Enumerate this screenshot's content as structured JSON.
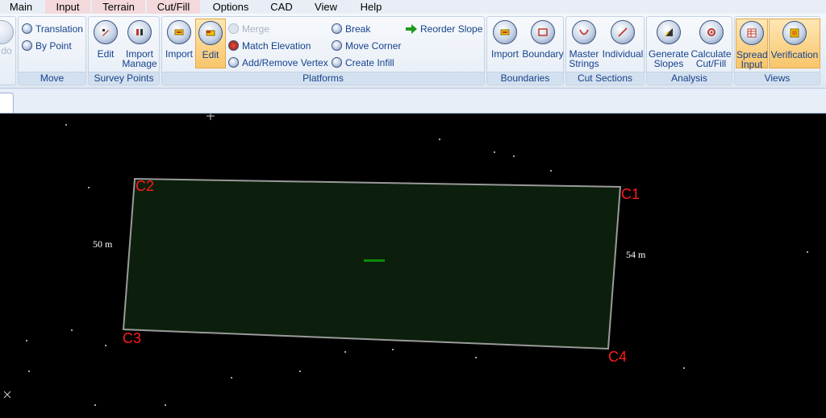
{
  "menu": {
    "items": [
      "Main",
      "Input",
      "Terrain",
      "Cut/Fill",
      "Options",
      "CAD",
      "View",
      "Help"
    ]
  },
  "ribbon": {
    "partial_label": "do",
    "move": {
      "translation": "Translation",
      "by_point": "By Point",
      "label": "Move"
    },
    "survey_points": {
      "edit": "Edit",
      "import_manage_1": "Import",
      "import_manage_2": "Manage",
      "label": "Survey Points"
    },
    "platforms": {
      "import": "Import",
      "edit": "Edit",
      "merge": "Merge",
      "match_elevation": "Match Elevation",
      "add_remove_vertex": "Add/Remove Vertex",
      "break": "Break",
      "move_corner": "Move Corner",
      "create_infill": "Create Infill",
      "reorder_slope": "Reorder Slope",
      "label": "Platforms"
    },
    "boundaries": {
      "import": "Import",
      "boundary": "Boundary",
      "label": "Boundaries"
    },
    "cut_sections": {
      "master_1": "Master",
      "master_2": "Strings",
      "individual": "Individual",
      "label": "Cut Sections"
    },
    "analysis": {
      "generate_1": "Generate",
      "generate_2": "Slopes",
      "calculate_1": "Calculate",
      "calculate_2": "Cut/Fill",
      "label": "Analysis"
    },
    "views": {
      "spread_1": "Spread",
      "spread_2": "Input",
      "verification": "Verification",
      "label": "Views"
    }
  },
  "canvas": {
    "corners": {
      "c1": "C1",
      "c2": "C2",
      "c3": "C3",
      "c4": "C4"
    },
    "dims": {
      "left": "50 m",
      "right": "54 m"
    },
    "colors": {
      "platform_fill": "#0c1f0c",
      "platform_edge": "#9a9a9a",
      "corner_label": "#ff1a1a",
      "marker": "#0a8a0a"
    }
  }
}
